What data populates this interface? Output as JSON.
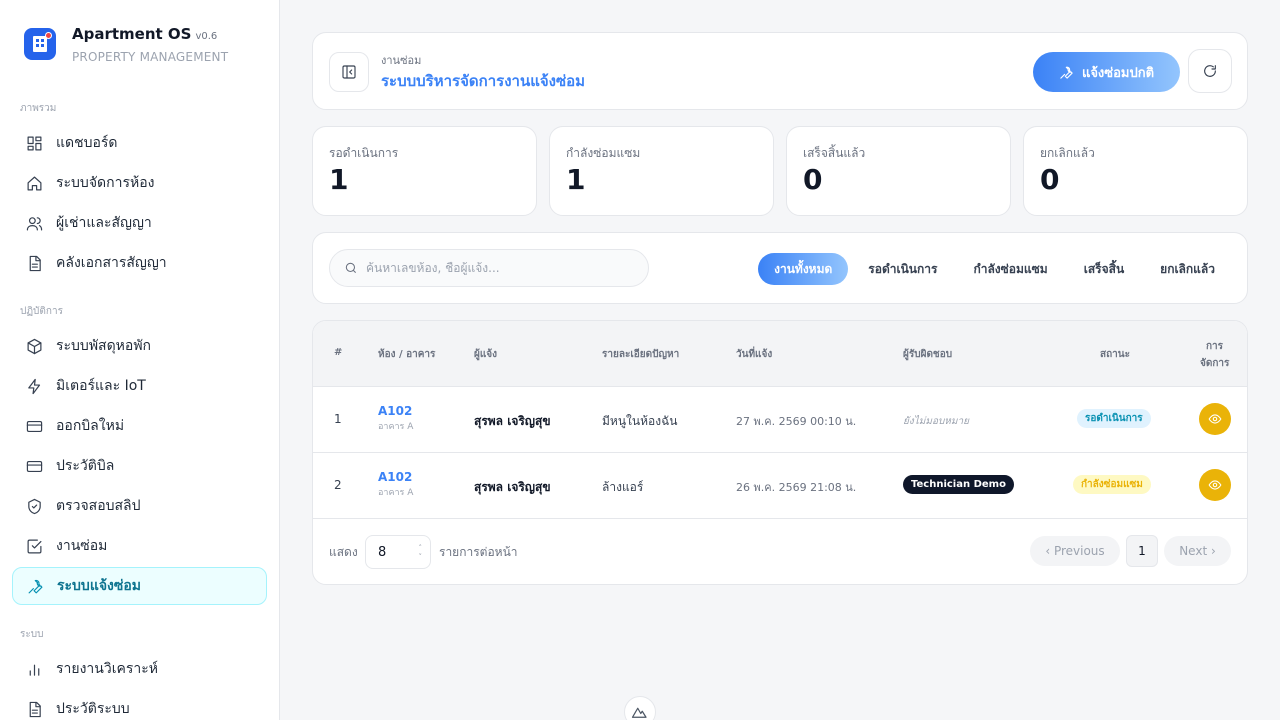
{
  "app": {
    "title": "Apartment OS",
    "version": "v0.6",
    "subtitle": "PROPERTY MANAGEMENT"
  },
  "sidebar": {
    "sections": [
      {
        "label": "ภาพรวม"
      },
      {
        "label": "ปฏิบัติการ"
      },
      {
        "label": "ระบบ"
      }
    ],
    "items": [
      {
        "label": "แดชบอร์ด",
        "icon": "dashboard-icon"
      },
      {
        "label": "ระบบจัดการห้อง",
        "icon": "home-icon"
      },
      {
        "label": "ผู้เช่าและสัญญา",
        "icon": "users-icon"
      },
      {
        "label": "คลังเอกสารสัญญา",
        "icon": "document-icon"
      },
      {
        "label": "ระบบพัสดุหอพัก",
        "icon": "package-icon"
      },
      {
        "label": "มิเตอร์และ IoT",
        "icon": "bolt-icon"
      },
      {
        "label": "ออกบิลใหม่",
        "icon": "card-icon"
      },
      {
        "label": "ประวัติบิล",
        "icon": "card-icon"
      },
      {
        "label": "ตรวจสอบสลิป",
        "icon": "shield-icon"
      },
      {
        "label": "งานซ่อม",
        "icon": "checkbox-icon"
      },
      {
        "label": "ระบบแจ้งซ่อม",
        "icon": "wrench-icon"
      },
      {
        "label": "รายงานวิเคราะห์",
        "icon": "bar-chart-icon"
      },
      {
        "label": "ประวัติระบบ",
        "icon": "document-icon"
      }
    ],
    "active_index": 10
  },
  "header": {
    "breadcrumb": "งานซ่อม",
    "title": "ระบบบริหารจัดการงานแจ้งซ่อม",
    "primary_button": "แจ้งซ่อมปกติ"
  },
  "stats": [
    {
      "label": "รอดำเนินการ",
      "value": "1"
    },
    {
      "label": "กำลังซ่อมแซม",
      "value": "1"
    },
    {
      "label": "เสร็จสิ้นแล้ว",
      "value": "0"
    },
    {
      "label": "ยกเลิกแล้ว",
      "value": "0"
    }
  ],
  "filter": {
    "search_placeholder": "ค้นหาเลขห้อง, ชื่อผู้แจ้ง...",
    "tabs": [
      "งานทั้งหมด",
      "รอดำเนินการ",
      "กำลังซ่อมแซม",
      "เสร็จสิ้น",
      "ยกเลิกแล้ว"
    ],
    "active_tab": 0
  },
  "table": {
    "headers": [
      "#",
      "ห้อง / อาคาร",
      "ผู้แจ้ง",
      "รายละเอียดปัญหา",
      "วันที่แจ้ง",
      "ผู้รับผิดชอบ",
      "สถานะ",
      "การ",
      "จัดการ"
    ],
    "rows": [
      {
        "no": "1",
        "room": "A102",
        "building": "อาคาร A",
        "reporter": "สุรพล เจริญสุข",
        "detail": "มีหนูในห้องฉัน",
        "date": "27 พ.ค. 2569 00:10 น.",
        "assignee": "ยังไม่มอบหมาย",
        "status": "รอดำเนินการ"
      },
      {
        "no": "2",
        "room": "A102",
        "building": "อาคาร A",
        "reporter": "สุรพล เจริญสุข",
        "detail": "ล้างแอร์",
        "date": "26 พ.ค. 2569 21:08 น.",
        "assignee": "Technician Demo",
        "status": "กำลังซ่อมแซม"
      }
    ]
  },
  "pagination": {
    "show_label": "แสดง",
    "per_page": "8",
    "per_page_suffix": "รายการต่อหน้า",
    "prev": "‹ Previous",
    "page": "1",
    "next": "Next ›"
  },
  "colors": {
    "accent": "#3b82f6",
    "active_nav": "#0891b2",
    "action": "#eab308"
  }
}
